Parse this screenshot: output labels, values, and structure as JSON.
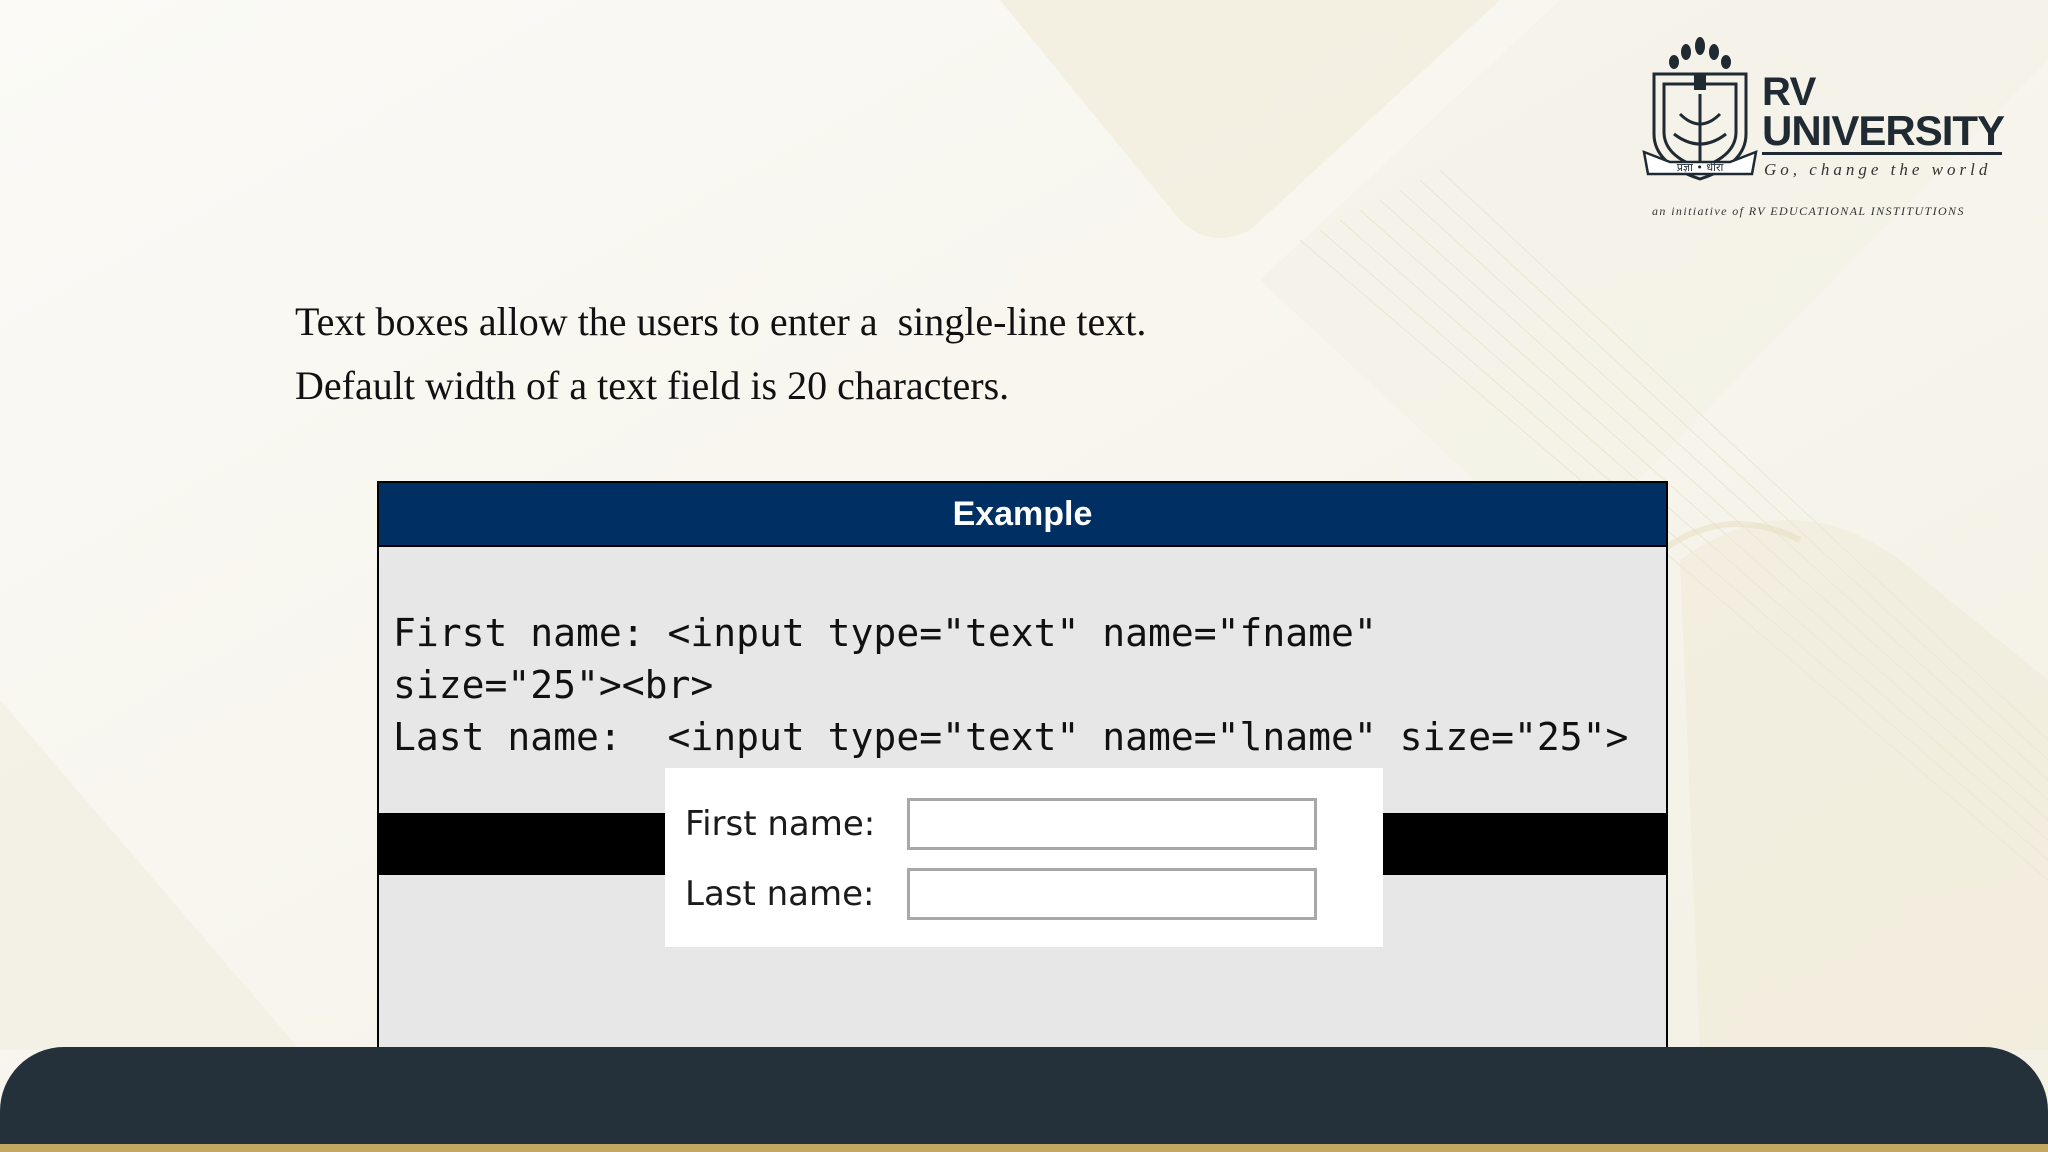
{
  "logo": {
    "line1": "RV",
    "line2": "UNIVERSITY",
    "tagline": "Go, change the world",
    "initiative": "an initiative of RV EDUCATIONAL INSTITUTIONS",
    "crest_text": "प्रज्ञा • धीरा"
  },
  "intro": {
    "line1": "Text boxes allow the users to enter a  single-line text.",
    "line2": "Default width of a text field is 20 characters."
  },
  "example": {
    "header": "Example",
    "code_line1": "First name: <input type=\"text\" name=\"fname\"",
    "code_line2": "size=\"25\"><br>",
    "code_line3": "Last name:  <input type=\"text\" name=\"lname\" size=\"25\">"
  },
  "preview": {
    "first_label": "First name:",
    "last_label": "Last name:",
    "first_value": "",
    "last_value": ""
  },
  "colors": {
    "header_bg": "#002f63",
    "footer_bg": "#24303a",
    "footer_accent": "#c4a862"
  }
}
